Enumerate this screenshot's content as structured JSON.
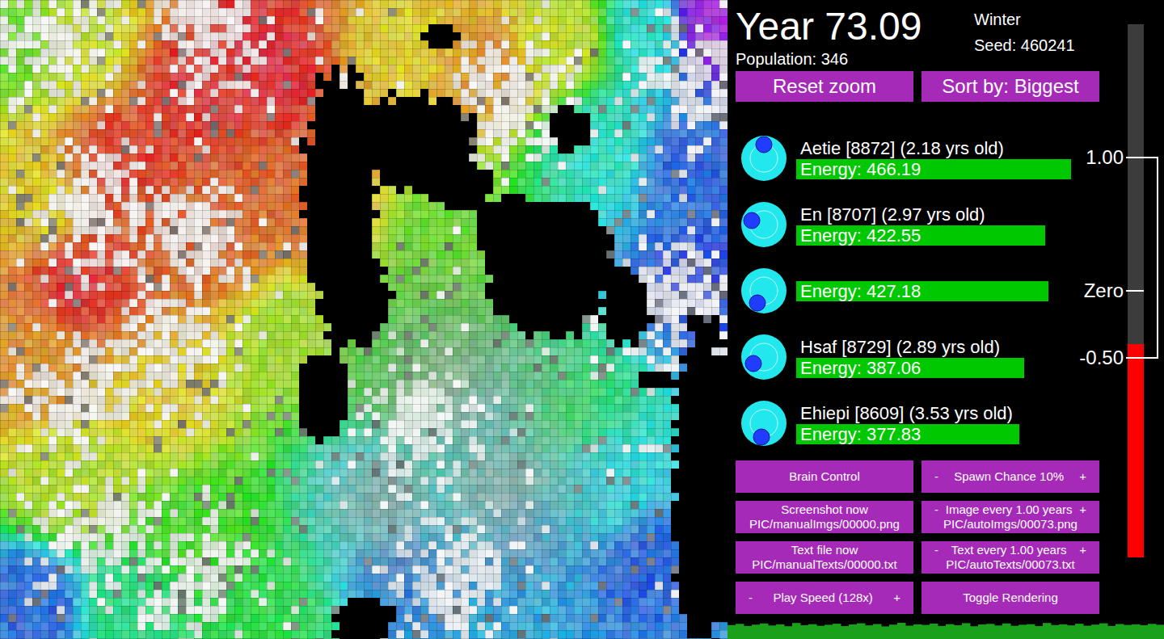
{
  "header": {
    "year": "Year 73.09",
    "population": "Population: 346",
    "season": "Winter",
    "seed": "Seed: 460241"
  },
  "top_buttons": [
    {
      "label": "Reset zoom"
    },
    {
      "label": "Sort by: Biggest"
    }
  ],
  "creatures": [
    {
      "kind": "full",
      "name": "Aetie [8872] (2.18 yrs old)",
      "energy": "Energy: 466.19",
      "level": 1.0
    },
    {
      "kind": "full",
      "name": "En [8707] (2.97 yrs old)",
      "energy": "Energy: 422.55",
      "level": 0.906
    },
    {
      "kind": "bar",
      "energy": "Energy: 427.18",
      "level": 0.918
    },
    {
      "kind": "full",
      "name": "Hsaf [8729] (2.89 yrs old)",
      "energy": "Energy: 387.06",
      "level": 0.829
    },
    {
      "kind": "full",
      "name": "Ehiepi [8609] (3.53 yrs old)",
      "energy": "Energy: 377.83",
      "level": 0.812
    }
  ],
  "controls": [
    {
      "kind": "plain",
      "label": "Brain Control"
    },
    {
      "kind": "stepper",
      "minus": "-",
      "label": "Spawn Chance 10%",
      "plus": "+"
    },
    {
      "kind": "plain",
      "label": "Screenshot now",
      "path": "PIC/manualImgs/00000.png"
    },
    {
      "kind": "stepper",
      "minus": "-",
      "label": "Image every 1.00 years",
      "plus": "+",
      "path": "PIC/autoImgs/00073.png"
    },
    {
      "kind": "plain",
      "label": "Text file now",
      "path": "PIC/manualTexts/00000.txt"
    },
    {
      "kind": "stepper",
      "minus": "-",
      "label": "Text every 1.00 years",
      "plus": "+",
      "path": "PIC/autoTexts/00073.txt"
    },
    {
      "kind": "stepper",
      "minus": "-",
      "label": "Play Speed (128x)",
      "plus": "+"
    },
    {
      "kind": "plain",
      "label": "Toggle Rendering"
    }
  ],
  "meter": {
    "level": 0.4,
    "ticks": [
      {
        "label": "1.00",
        "value": 1,
        "kind": "bound"
      },
      {
        "label": "Zero",
        "value": 0,
        "kind": "zero"
      },
      {
        "label": "-0.50",
        "value": -0.5,
        "kind": "bound"
      }
    ]
  },
  "population_graph": {
    "values": [
      344,
      352,
      338,
      347,
      355,
      341,
      349,
      336,
      358,
      343,
      350,
      339,
      346,
      353,
      337,
      348,
      356,
      342,
      351,
      335,
      347,
      359,
      340,
      349,
      345,
      354,
      338,
      350,
      343,
      357,
      336,
      348,
      352,
      341,
      355,
      339,
      346,
      350,
      337,
      358,
      344,
      349,
      342,
      353,
      340,
      347,
      356,
      338,
      351,
      345,
      349,
      343,
      352,
      346
    ]
  }
}
